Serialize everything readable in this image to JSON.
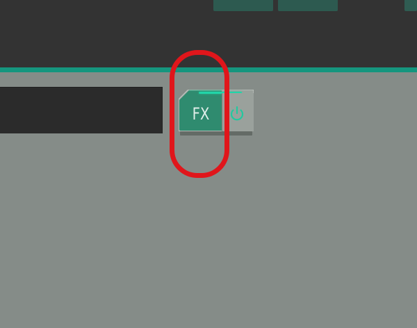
{
  "header": {
    "tabs": [
      "",
      "",
      ""
    ]
  },
  "fx_module": {
    "label": "FX",
    "active": true,
    "power_icon": "power-icon",
    "colors": {
      "button_fill": "#2f8b6f",
      "active_led": "#21d5a8",
      "power_glyph": "#22c99f"
    }
  },
  "annotation": {
    "shape": "rounded-rectangle",
    "color": "#e0161b"
  },
  "theme": {
    "header_bg": "#333333",
    "accent_line": "#15967e",
    "body_bg": "#858c88",
    "panel_bg": "#2b2b2b"
  }
}
